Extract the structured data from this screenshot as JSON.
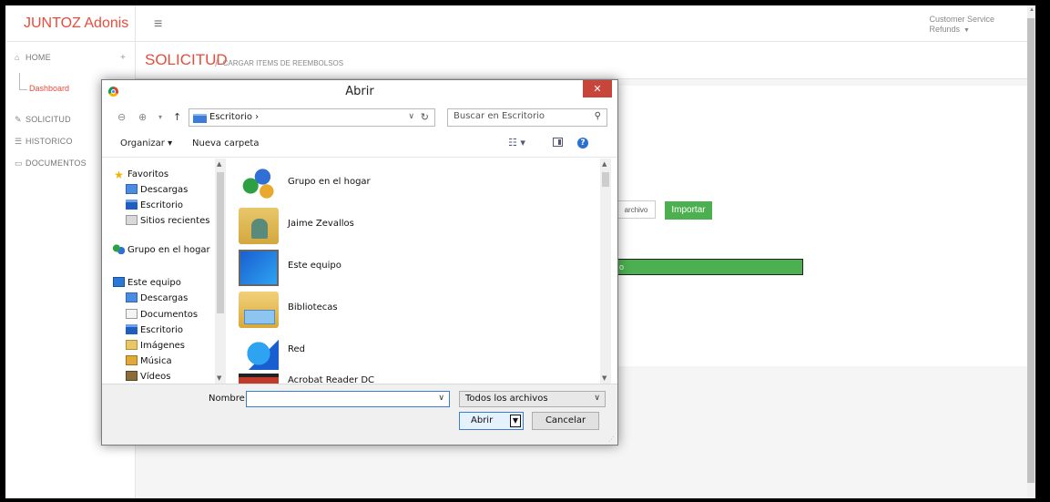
{
  "app": {
    "brand": "JUNTOZ Adonis",
    "menu_icon": "hamburger-icon"
  },
  "user_menu": {
    "line1": "Customer Service",
    "line2": "Refunds"
  },
  "sidebar": {
    "home": "HOME",
    "dashboard": "Dashboard",
    "items": [
      {
        "label": "SOLICITUD",
        "icon": "edit-icon"
      },
      {
        "label": "HISTORICO",
        "icon": "list-icon"
      },
      {
        "label": "DOCUMENTOS",
        "icon": "folder-icon"
      }
    ]
  },
  "page": {
    "title": "SOLICITUD",
    "breadcrumb": "CARGAR ITEMS DE REEMBOLSOS",
    "file_button": "archivo",
    "import_button": "Importar",
    "progress_text": "o",
    "accent_color": "#e74c3c",
    "success_color": "#4caf50"
  },
  "dialog": {
    "title": "Abrir",
    "close": "✕",
    "address": "Escritorio",
    "search_placeholder": "Buscar en Escritorio",
    "organize": "Organizar ▾",
    "new_folder": "Nueva carpeta",
    "nav_pane": [
      {
        "label": "Favoritos",
        "icon": "star-icon",
        "indent": 0
      },
      {
        "label": "Descargas",
        "icon": "downloads-icon",
        "indent": 1
      },
      {
        "label": "Escritorio",
        "icon": "desktop-icon",
        "indent": 1
      },
      {
        "label": "Sitios recientes",
        "icon": "recent-icon",
        "indent": 1
      },
      {
        "label": "Grupo en el hogar",
        "icon": "homegroup-icon",
        "indent": 0
      },
      {
        "label": "Este equipo",
        "icon": "computer-icon",
        "indent": 0
      },
      {
        "label": "Descargas",
        "icon": "downloads-icon",
        "indent": 1
      },
      {
        "label": "Documentos",
        "icon": "documents-icon",
        "indent": 1
      },
      {
        "label": "Escritorio",
        "icon": "desktop-icon",
        "indent": 1
      },
      {
        "label": "Imágenes",
        "icon": "pictures-icon",
        "indent": 1
      },
      {
        "label": "Música",
        "icon": "music-icon",
        "indent": 1
      },
      {
        "label": "Vídeos",
        "icon": "videos-icon",
        "indent": 1
      }
    ],
    "files": [
      {
        "label": "Grupo en el hogar",
        "icon": "homegroup-icon"
      },
      {
        "label": "Jaime Zevallos",
        "icon": "user-folder-icon"
      },
      {
        "label": "Este equipo",
        "icon": "computer-icon"
      },
      {
        "label": "Bibliotecas",
        "icon": "libraries-icon"
      },
      {
        "label": "Red",
        "icon": "network-icon"
      },
      {
        "label": "Acrobat Reader DC",
        "icon": "acrobat-icon"
      }
    ],
    "name_label": "Nombre:",
    "name_value": "",
    "file_type": "Todos los archivos",
    "open_button": "Abrir",
    "cancel_button": "Cancelar"
  }
}
